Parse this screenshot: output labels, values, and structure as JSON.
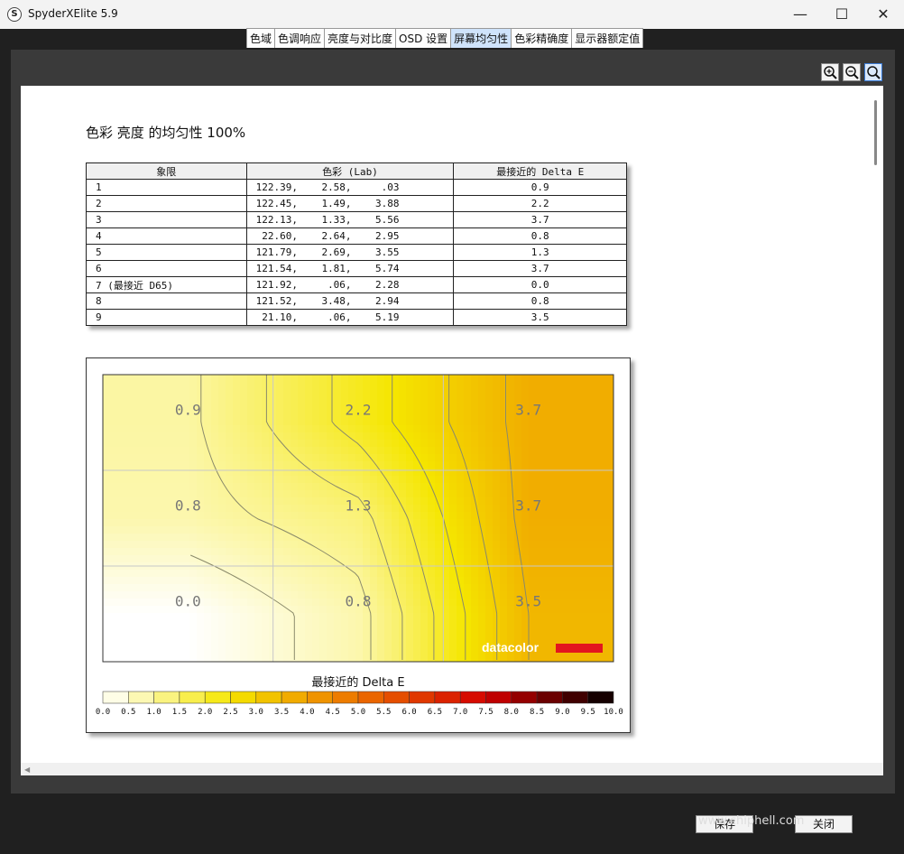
{
  "window": {
    "title": "SpyderXElite 5.9",
    "icon": "S",
    "minimize": "—",
    "maximize": "☐",
    "close": "✕"
  },
  "tabs": [
    {
      "label": "色域"
    },
    {
      "label": "色调响应"
    },
    {
      "label": "亮度与对比度"
    },
    {
      "label": "OSD 设置"
    },
    {
      "label": "屏幕均匀性",
      "active": true
    },
    {
      "label": "色彩精确度"
    },
    {
      "label": "显示器额定值"
    }
  ],
  "zoom": {
    "zoom_in": "zoom-in-icon",
    "zoom_out": "zoom-out-icon",
    "zoom_fit": "zoom-fit-icon"
  },
  "report": {
    "title": "色彩 亮度 的均匀性 100%",
    "table": {
      "headers": [
        "象限",
        "色彩 (Lab)",
        "最接近的 Delta E"
      ],
      "rows": [
        {
          "quadrant": "1",
          "lab": "122.39,    2.58,     .03",
          "delta_e": "0.9"
        },
        {
          "quadrant": "2",
          "lab": "122.45,    1.49,    3.88",
          "delta_e": "2.2"
        },
        {
          "quadrant": "3",
          "lab": "122.13,    1.33,    5.56",
          "delta_e": "3.7"
        },
        {
          "quadrant": "4",
          "lab": " 22.60,    2.64,    2.95",
          "delta_e": "0.8"
        },
        {
          "quadrant": "5",
          "lab": "121.79,    2.69,    3.55",
          "delta_e": "1.3"
        },
        {
          "quadrant": "6",
          "lab": "121.54,    1.81,    5.74",
          "delta_e": "3.7"
        },
        {
          "quadrant": "7 (最接近 D65)",
          "lab": "121.92,     .06,    2.28",
          "delta_e": "0.0"
        },
        {
          "quadrant": "8",
          "lab": "121.52,    3.48,    2.94",
          "delta_e": "0.8"
        },
        {
          "quadrant": "9",
          "lab": " 21.10,     .06,    5.19",
          "delta_e": "3.5"
        }
      ]
    }
  },
  "chart_data": {
    "type": "heatmap",
    "grid": {
      "rows": 3,
      "cols": 3
    },
    "values": [
      [
        0.9,
        2.2,
        3.7
      ],
      [
        0.8,
        1.3,
        3.7
      ],
      [
        0.0,
        0.8,
        3.5
      ]
    ],
    "labels": [
      [
        "0.9",
        "2.2",
        "3.7"
      ],
      [
        "0.8",
        "1.3",
        "3.7"
      ],
      [
        "0.0",
        "0.8",
        "3.5"
      ]
    ],
    "colorbar_title": "最接近的 Delta E",
    "colorbar_ticks": [
      "0.0",
      "0.5",
      "1.0",
      "1.5",
      "2.0",
      "2.5",
      "3.0",
      "3.5",
      "4.0",
      "4.5",
      "5.0",
      "5.5",
      "6.0",
      "6.5",
      "7.0",
      "7.5",
      "8.0",
      "8.5",
      "9.0",
      "9.5",
      "10.0"
    ],
    "range": [
      0,
      10
    ],
    "colormap": [
      "#ffffff",
      "#f5e600",
      "#ec7000",
      "#d40000",
      "#000000"
    ],
    "logo": "datacolor"
  },
  "buttons": {
    "save": "保存",
    "close": "关闭"
  },
  "watermark": "www.chiphell.com"
}
